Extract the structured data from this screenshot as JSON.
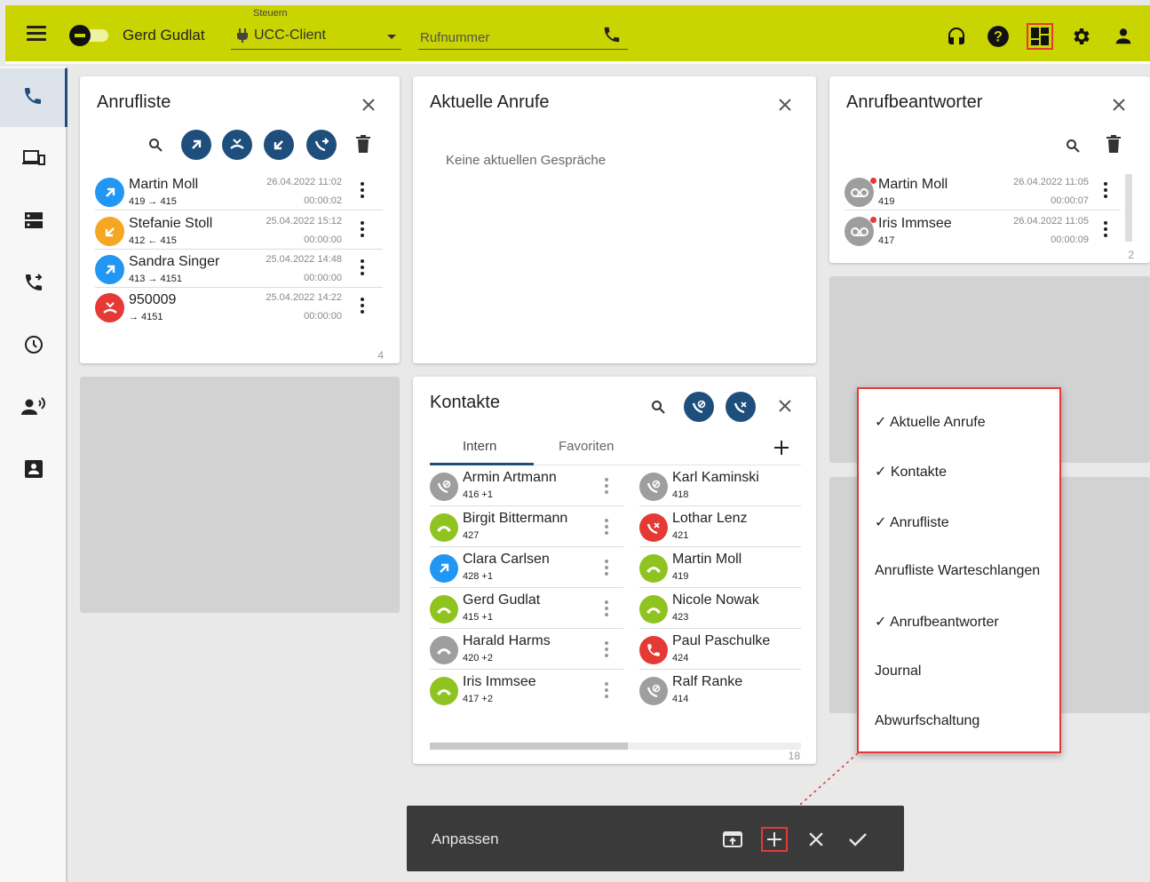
{
  "topbar": {
    "username": "Gerd Gudlat",
    "steuern_label": "Steuern",
    "client_select_value": "UCC-Client",
    "phone_placeholder": "Rufnummer",
    "bg_color": "#c9d400"
  },
  "sidebar": {
    "items": [
      "phone-icon",
      "devices-icon",
      "server-icon",
      "call-forward-icon",
      "history-icon",
      "voice-icon",
      "contact-card-icon"
    ]
  },
  "anrufliste": {
    "title": "Anrufliste",
    "count": "4",
    "entries": [
      {
        "name": "Martin Moll",
        "sub": "419 → 415",
        "date": "26.04.2022 11:02",
        "duration": "00:00:02",
        "type": "outgoing"
      },
      {
        "name": "Stefanie Stoll",
        "sub": "412 ← 415",
        "date": "25.04.2022 15:12",
        "duration": "00:00:00",
        "type": "incoming"
      },
      {
        "name": "Sandra Singer",
        "sub": "413 → 4151",
        "date": "25.04.2022 14:48",
        "duration": "00:00:00",
        "type": "outgoing"
      },
      {
        "name": "950009",
        "sub": "→ 4151",
        "date": "25.04.2022 14:22",
        "duration": "00:00:00",
        "type": "missed"
      }
    ]
  },
  "aktuelle_anrufe": {
    "title": "Aktuelle Anrufe",
    "empty_text": "Keine aktuellen Gespräche"
  },
  "anrufbeantworter": {
    "title": "Anrufbeantworter",
    "count": "2",
    "entries": [
      {
        "name": "Martin Moll",
        "ext": "419",
        "date": "26.04.2022 11:05",
        "duration": "00:00:07"
      },
      {
        "name": "Iris Immsee",
        "ext": "417",
        "date": "26.04.2022 11:05",
        "duration": "00:00:09"
      }
    ]
  },
  "kontakte": {
    "title": "Kontakte",
    "count": "18",
    "tabs": [
      "Intern",
      "Favoriten"
    ],
    "active_tab": "Intern",
    "left": [
      {
        "name": "Armin Artmann",
        "ext": "416 +1",
        "status": "offline-dnd"
      },
      {
        "name": "Birgit Bittermann",
        "ext": "427",
        "status": "available"
      },
      {
        "name": "Clara Carlsen",
        "ext": "428 +1",
        "status": "outgoing"
      },
      {
        "name": "Gerd Gudlat",
        "ext": "415 +1",
        "status": "available"
      },
      {
        "name": "Harald Harms",
        "ext": "420 +2",
        "status": "offline"
      },
      {
        "name": "Iris Immsee",
        "ext": "417 +2",
        "status": "available"
      }
    ],
    "right": [
      {
        "name": "Karl Kaminski",
        "ext": "418",
        "status": "offline-dnd"
      },
      {
        "name": "Lothar Lenz",
        "ext": "421",
        "status": "dnd"
      },
      {
        "name": "Martin Moll",
        "ext": "419",
        "status": "available"
      },
      {
        "name": "Nicole Nowak",
        "ext": "423",
        "status": "available"
      },
      {
        "name": "Paul Paschulke",
        "ext": "424",
        "status": "busy"
      },
      {
        "name": "Ralf Ranke",
        "ext": "414",
        "status": "offline-dnd"
      }
    ]
  },
  "popup_menu": {
    "items": [
      "✓ Aktuelle Anrufe",
      "✓ Kontakte",
      "✓ Anrufliste",
      "Anrufliste Warteschlangen",
      "✓ Anrufbeantworter",
      "Journal",
      "Abwurfschaltung"
    ]
  },
  "bottombar": {
    "label": "Anpassen"
  },
  "colors": {
    "navy": "#1e4e7c",
    "blue": "#2196f3",
    "orange": "#f5a623",
    "red": "#e53935",
    "green": "#8fc31f",
    "grey": "#9e9e9e"
  }
}
